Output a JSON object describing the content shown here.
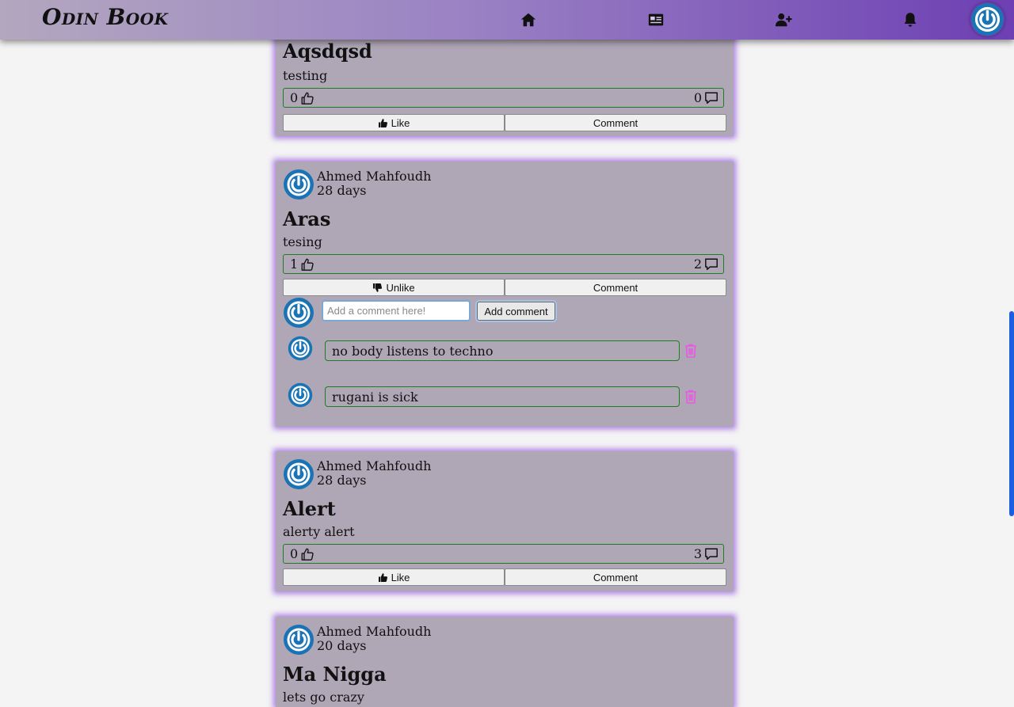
{
  "app": {
    "logo": "Odin Book"
  },
  "nav": {
    "home_icon": "home-icon",
    "profile_card_icon": "id-card-icon",
    "friend_add_icon": "user-plus-icon",
    "notifications_icon": "bell-icon",
    "avatar_icon": "power-icon"
  },
  "colors": {
    "nav_start": "#b3a7bf",
    "nav_end": "#6d3fb3",
    "card_bg": "#afa6b6",
    "card_glow": "#9a5ae1",
    "stats_border": "#1e7d1e",
    "trash": "#e85be0",
    "avatar_blue": "#1a73b5"
  },
  "posts": [
    {
      "title": "Aqsdqsd",
      "body": "testing",
      "likes": "0",
      "comments": "0",
      "action_like": "Like",
      "action_comment": "Comment"
    },
    {
      "author": "Ahmed Mahfoudh",
      "time": "28 days",
      "title": "Aras",
      "body": "tesing",
      "likes": "1",
      "comments": "2",
      "action_like": "Unlike",
      "action_comment": "Comment",
      "comment_placeholder": "Add a comment here!",
      "add_comment_label": "Add comment",
      "comment_list": [
        {
          "text": "no body listens to techno"
        },
        {
          "text": "rugani is sick"
        }
      ]
    },
    {
      "author": "Ahmed Mahfoudh",
      "time": "28 days",
      "title": "Alert",
      "body": "alerty alert",
      "likes": "0",
      "comments": "3",
      "action_like": "Like",
      "action_comment": "Comment"
    },
    {
      "author": "Ahmed Mahfoudh",
      "time": "20 days",
      "title": "Ma Nigga",
      "body": "lets go crazy"
    }
  ]
}
